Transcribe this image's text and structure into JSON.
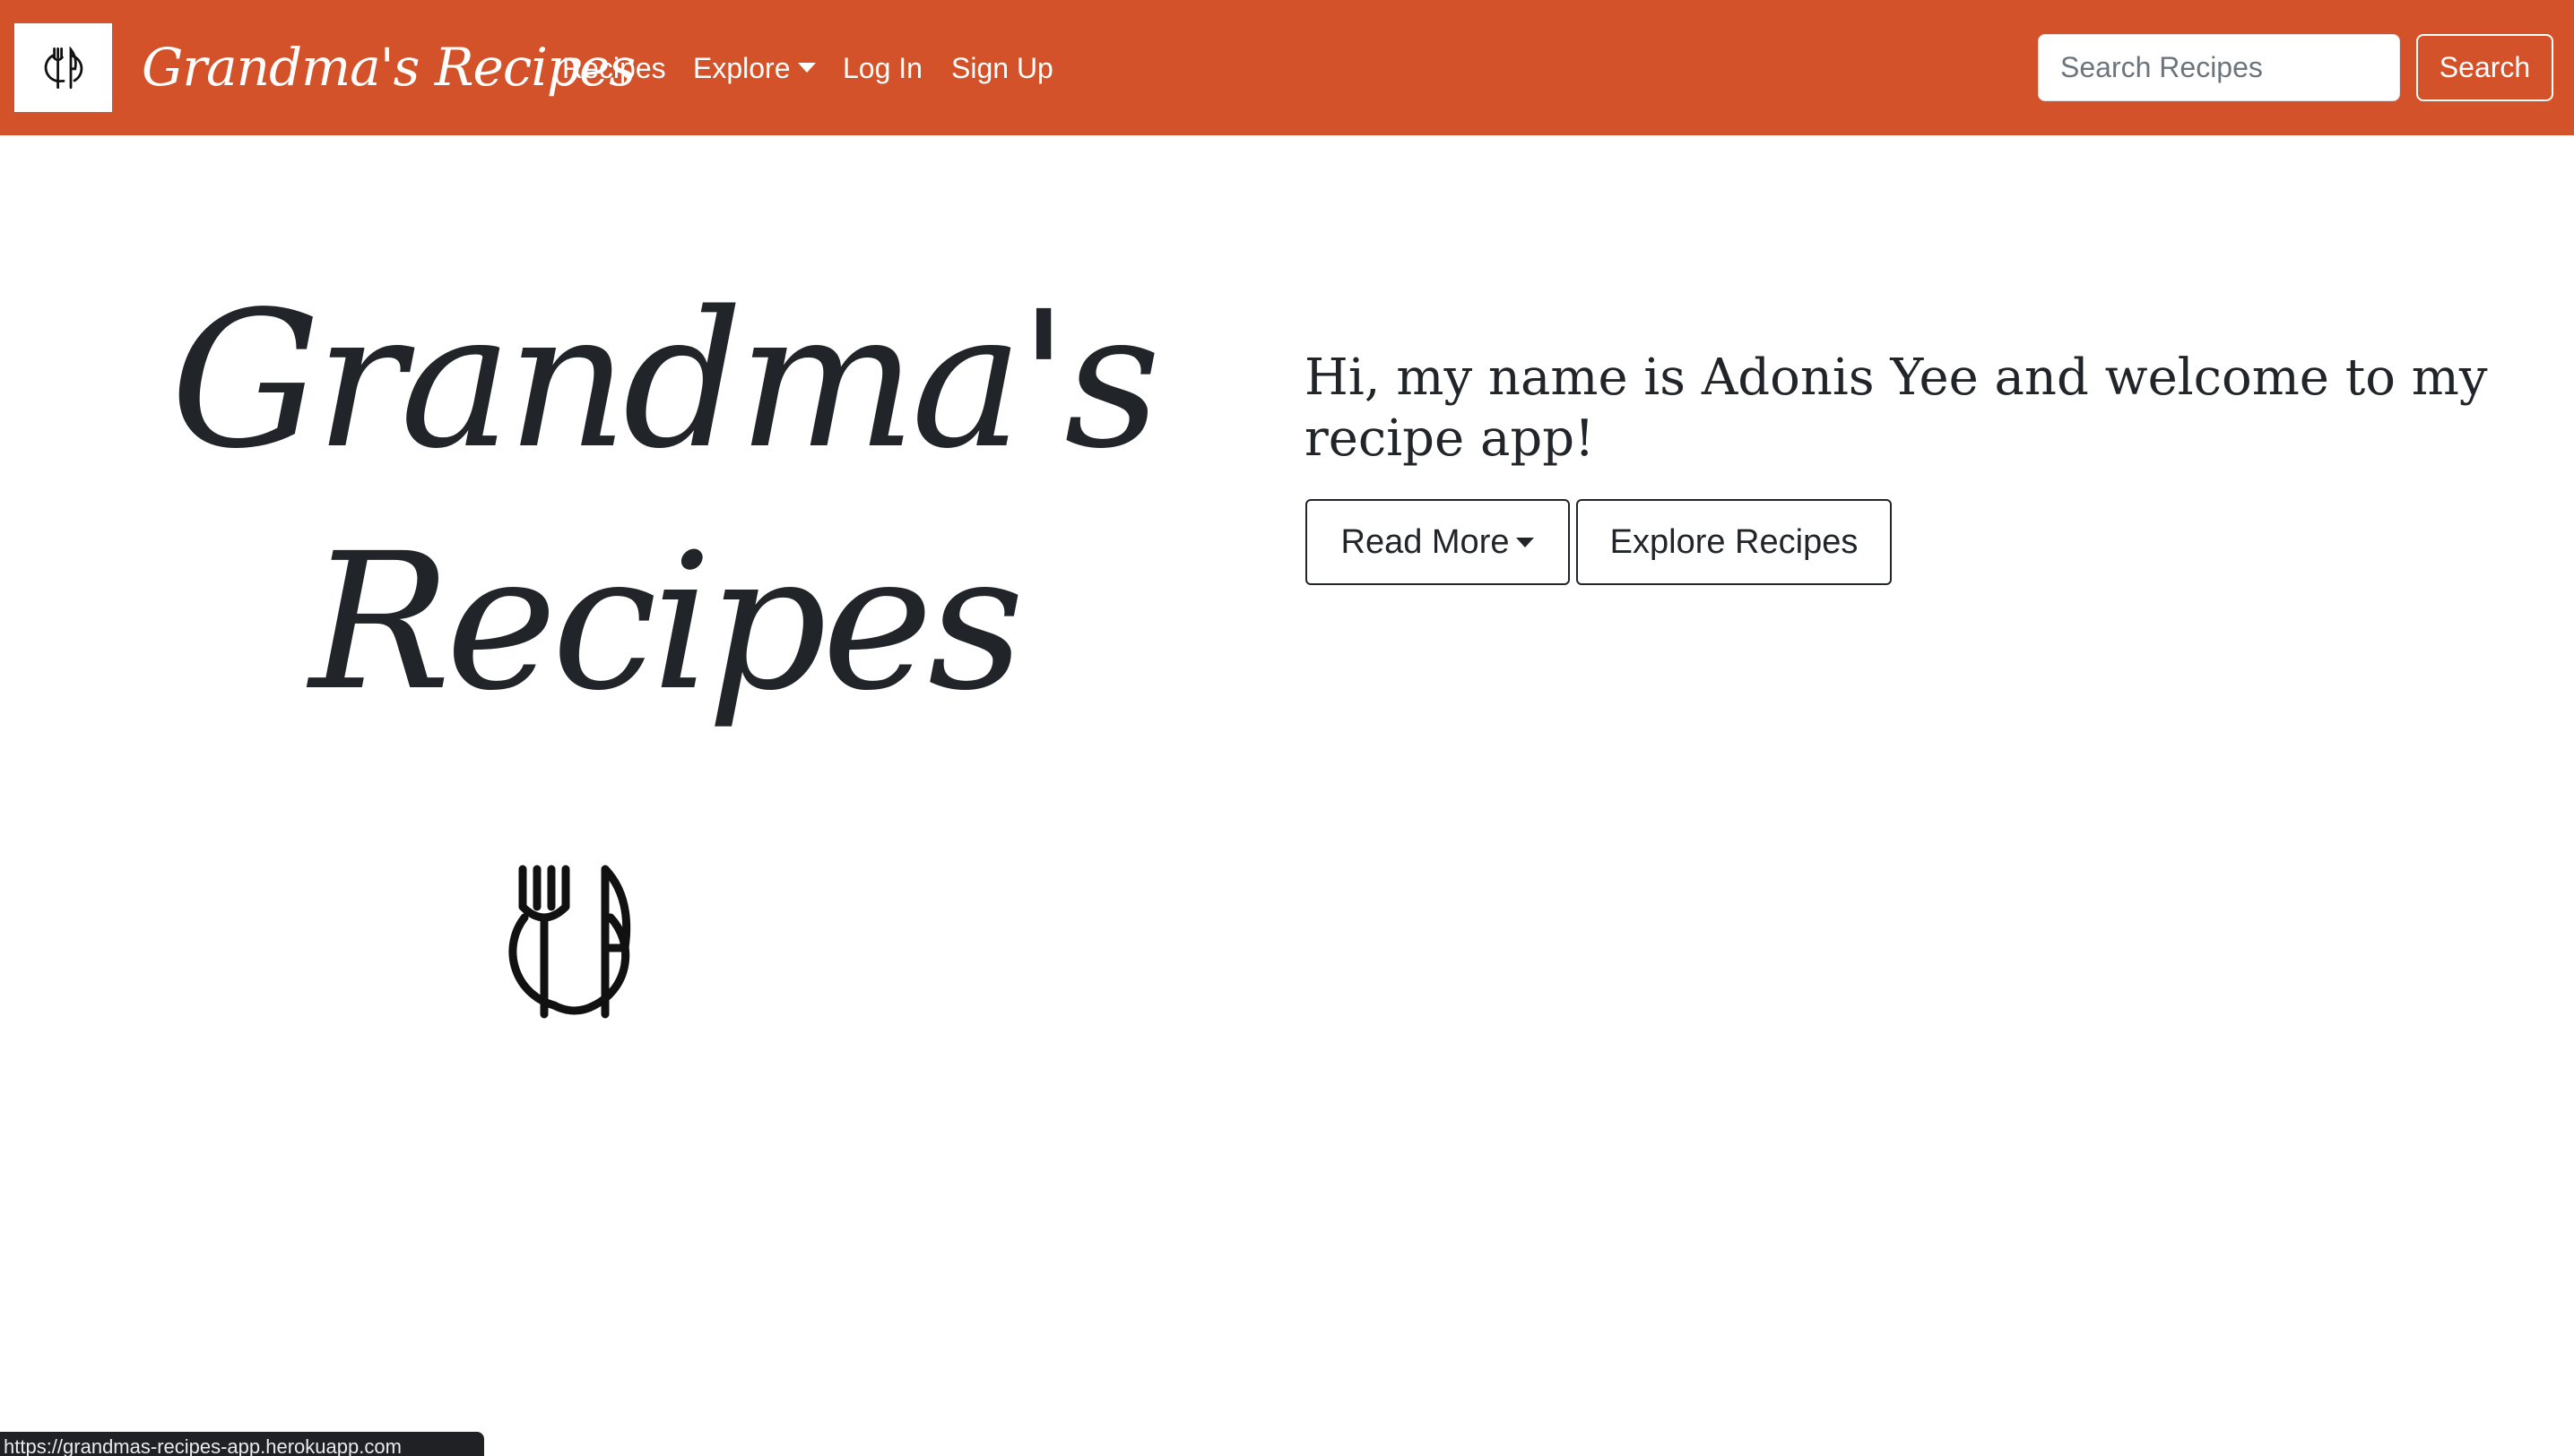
{
  "nav": {
    "brand": "Grandma's Recipes",
    "links": {
      "recipes": "Recipes",
      "explore": "Explore",
      "login": "Log In",
      "signup": "Sign Up"
    },
    "search": {
      "placeholder": "Search Recipes",
      "button": "Search"
    },
    "icons": {
      "logo": "fork-knife-plate-icon",
      "explore_caret": "caret-down-icon"
    }
  },
  "hero": {
    "title_line1": "Grandma's",
    "title_line2": "Recipes",
    "icon": "fork-knife-plate-icon",
    "welcome": "Hi, my name is Adonis Yee and welcome to my recipe app!",
    "buttons": {
      "read_more": "Read More",
      "explore_recipes": "Explore Recipes"
    }
  },
  "status_bar": {
    "url": "https://grandmas-recipes-app.herokuapp.com"
  },
  "colors": {
    "navbar": "#d35229",
    "text": "#212529",
    "white": "#ffffff"
  }
}
